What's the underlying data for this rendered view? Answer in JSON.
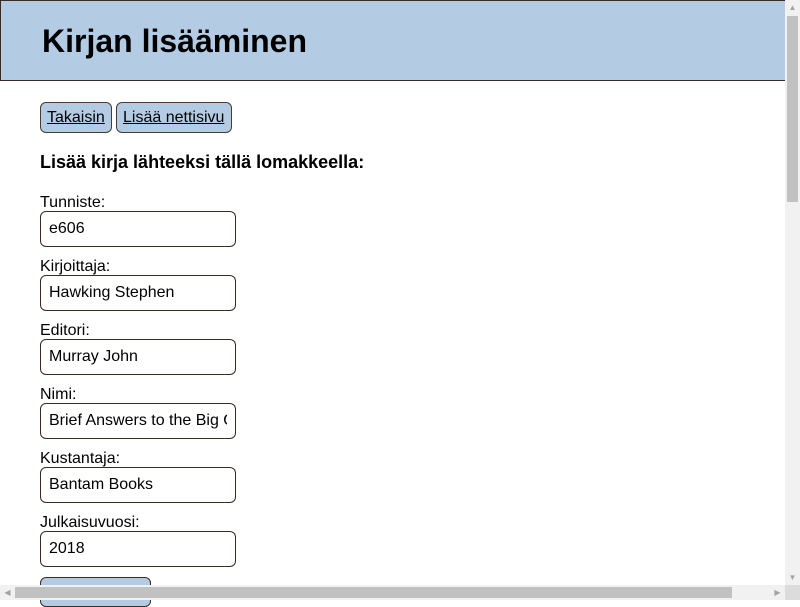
{
  "header": {
    "title": "Kirjan lisääminen"
  },
  "nav": {
    "back": "Takaisin",
    "add_website": "Lisää nettisivu"
  },
  "form": {
    "heading": "Lisää kirja lähteeksi tällä lomakkeella:",
    "fields": [
      {
        "label": "Tunniste:",
        "value": "e606"
      },
      {
        "label": "Kirjoittaja:",
        "value": "Hawking Stephen"
      },
      {
        "label": "Editori:",
        "value": "Murray John"
      },
      {
        "label": "Nimi:",
        "value": "Brief Answers to the Big Questions"
      },
      {
        "label": "Kustantaja:",
        "value": "Bantam Books"
      },
      {
        "label": "Julkaisuvuosi:",
        "value": "2018"
      }
    ]
  }
}
